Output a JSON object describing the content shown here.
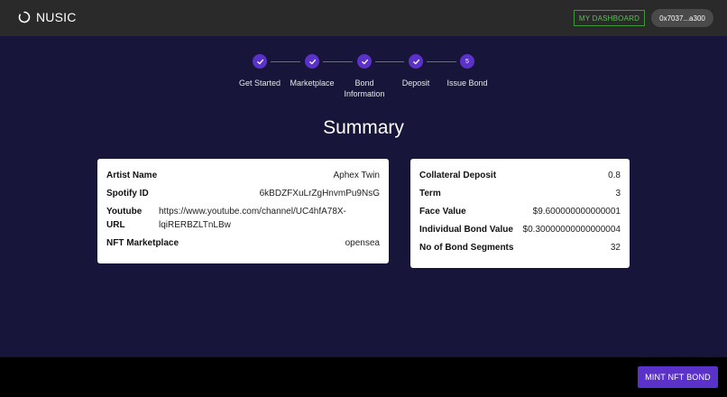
{
  "header": {
    "brand": "NUSIC",
    "dashboard_label": "MY DASHBOARD",
    "wallet_address": "0x7037...a300"
  },
  "stepper": {
    "steps": [
      {
        "label_line1": "Get Started",
        "label_line2": "",
        "state": "complete"
      },
      {
        "label_line1": "Marketplace",
        "label_line2": "",
        "state": "complete"
      },
      {
        "label_line1": "Bond",
        "label_line2": "Information",
        "state": "complete"
      },
      {
        "label_line1": "Deposit",
        "label_line2": "",
        "state": "complete"
      },
      {
        "label_line1": "Issue Bond",
        "label_line2": "",
        "state": "current",
        "number": "5"
      }
    ]
  },
  "summary": {
    "title": "Summary",
    "left_card": {
      "artist_name_label": "Artist Name",
      "artist_name_value": "Aphex Twin",
      "spotify_label": "Spotify ID",
      "spotify_value": "6kBDZFXuLrZgHnvmPu9NsG",
      "youtube_label_1": "Youtube",
      "youtube_label_2": "URL",
      "youtube_value_1": "https://www.youtube.com/channel/UC4hfA78X-",
      "youtube_value_2": "lqiRERBZLTnLBw",
      "marketplace_label": "NFT Marketplace",
      "marketplace_value": "opensea"
    },
    "right_card": {
      "collateral_label": "Collateral Deposit",
      "collateral_value": "0.8",
      "term_label": "Term",
      "term_value": "3",
      "face_value_label": "Face Value",
      "face_value_value": "$9.600000000000001",
      "individual_label": "Individual Bond Value",
      "individual_value": "$0.30000000000000004",
      "segments_label": "No of Bond Segments",
      "segments_value": "32"
    }
  },
  "footer": {
    "mint_label": "MINT NFT BOND"
  },
  "colors": {
    "background": "#17163a",
    "topbar": "#2a2a2a",
    "accent": "#5b32c9",
    "dashboard_green": "#5fbf57"
  }
}
